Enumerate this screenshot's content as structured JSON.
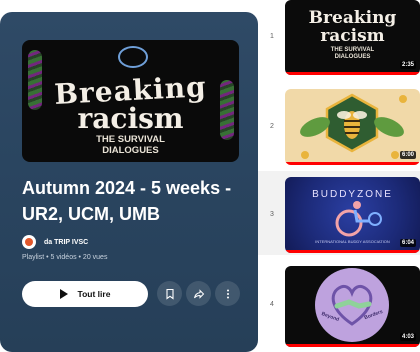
{
  "playlist": {
    "thumbnail": {
      "title_line1": "Breaking",
      "title_line2": "racism",
      "subtitle_line1": "THE SURVIVAL",
      "subtitle_line2": "DIALOGUES"
    },
    "title": "Autumn 2024 - 5 weeks - UR2, UCM, UMB",
    "channel": "da TRIP IVSC",
    "meta": "Playlist • 5 vidéos • 20 vues",
    "play_all_label": "Tout lire"
  },
  "videos": [
    {
      "index": "1",
      "duration": "2:35",
      "thumb_title1": "Breaking",
      "thumb_title2": "racism",
      "thumb_sub1": "THE SURVIVAL",
      "thumb_sub2": "DIALOGUES",
      "watched": 1.0
    },
    {
      "index": "2",
      "duration": "6:00",
      "watched": 1.0
    },
    {
      "index": "3",
      "duration": "6:04",
      "thumb_title": "BUDDYZONE",
      "thumb_caption": "INTERNATIONAL BUDDY ASSOCIATION",
      "watched": 1.0
    },
    {
      "index": "4",
      "duration": "4:03",
      "thumb_caption_top": "Beyond",
      "thumb_caption_bottom": "Borders",
      "watched": 1.0
    }
  ],
  "icons": {
    "save": "bookmark-plus-icon",
    "share": "share-icon",
    "more": "more-vertical-icon"
  },
  "colors": {
    "panel": "#2c4762",
    "progress": "#ff0000",
    "hero_bg": "#0a0a0a",
    "honey_bg": "#f1d9a8",
    "buddy_bg": "#1c2a78",
    "heart_bg": "#bea2de"
  }
}
